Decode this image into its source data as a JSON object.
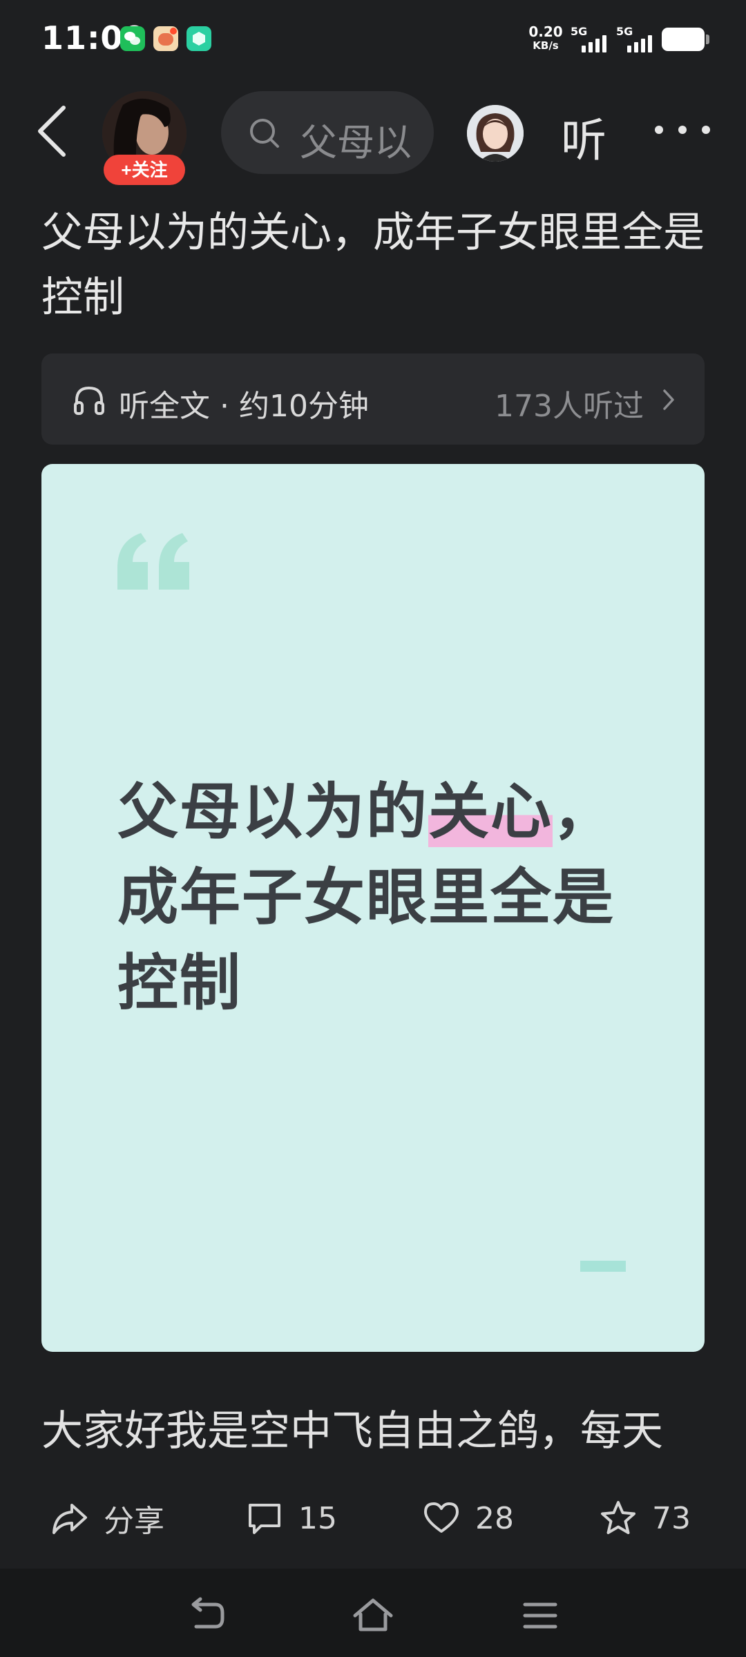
{
  "status_bar": {
    "time": "11:00",
    "net_speed_value": "0.20",
    "net_speed_unit": "KB/s",
    "signal1_label": "5G",
    "signal2_label": "5G",
    "notification_icons": [
      "wechat-icon",
      "app-icon",
      "cube-app-icon"
    ]
  },
  "nav": {
    "follow_label": "+关注",
    "search_text": "父母以为",
    "listen_label": "听"
  },
  "article": {
    "title": "父母以为的关心，成年子女眼里全是控制",
    "listen_text": "听全文 · 约10分钟",
    "listened_text": "173人听过",
    "cover": {
      "line1_pre": "父母以为的",
      "line1_highlight": "关心",
      "line1_post": "，",
      "line2": "成年子女眼里全是",
      "line3": "控制"
    },
    "body_preview": "大家好我是空中飞自由之鸽，每天"
  },
  "actions": {
    "share_label": "分享",
    "comment_count": "15",
    "like_count": "28",
    "favorite_count": "73"
  },
  "colors": {
    "background": "#1e1f21",
    "follow_button": "#f0433a",
    "cover_background": "#d3f0ed",
    "highlight": "#f2b6dd"
  }
}
